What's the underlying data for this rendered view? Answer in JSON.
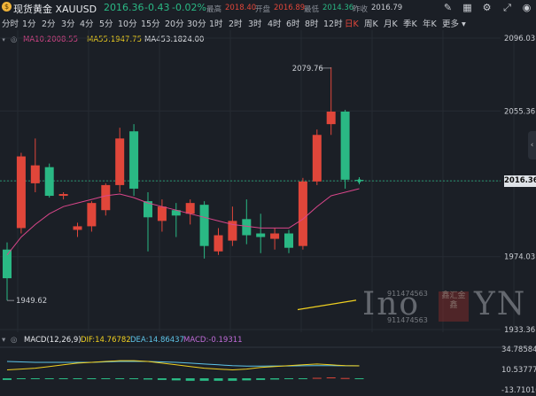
{
  "header": {
    "symbol": "现货黄金 XAUUSD",
    "price": "2016.36",
    "change": "-0.43",
    "change_pct": "-0.02%",
    "high_label": "最高",
    "high": "2018.40",
    "open_label": "开盘",
    "open": "2016.89",
    "low_label": "最低",
    "low": "2014.36",
    "prev_close_label": "昨收",
    "prev_close": "2016.79"
  },
  "timeframes": [
    "分时",
    "1分",
    "2分",
    "3分",
    "4分",
    "5分",
    "10分",
    "15分",
    "20分",
    "30分",
    "1时",
    "2时",
    "3时",
    "4时",
    "6时",
    "8时",
    "12时",
    "日K",
    "周K",
    "月K",
    "季K",
    "年K",
    "更多"
  ],
  "active_timeframe": "日K",
  "ma_legend": {
    "ma10": "MA10:2008.55",
    "ma55": "MA55:1947.75",
    "ma453": "MA453:1824.00"
  },
  "price_axis": [
    "2096.03",
    "2055.36",
    "2016.36",
    "1974.03",
    "1933.36"
  ],
  "price_tag": "2016.36",
  "annotations": {
    "high": "2079.76",
    "low": "1949.62"
  },
  "macd_legend": {
    "title": "MACD(12,26,9)",
    "dif": "DIF:14.76782",
    "dea": "DEA:14.86437",
    "macd": "MACD:-0.19311"
  },
  "macd_axis": [
    "34.78584",
    "10.53777",
    "-13.71010"
  ],
  "watermark": {
    "text_left": "Ino",
    "text_right": "YN",
    "number": "911474563",
    "seal": "鑫汇金鑫"
  },
  "colors": {
    "up": "#e0463a",
    "down": "#2ab884",
    "ma10": "#d9468a",
    "ma55": "#f0d020",
    "bg": "#1b1f26"
  },
  "chart_data": {
    "type": "candlestick",
    "title": "现货黄金 XAUUSD",
    "ylim": [
      1933.36,
      2096.03
    ],
    "candles": [
      {
        "o": 1978,
        "h": 1982,
        "l": 1949.62,
        "c": 1962
      },
      {
        "o": 1990,
        "h": 2032,
        "l": 1987,
        "c": 2030
      },
      {
        "o": 2015,
        "h": 2040,
        "l": 2010,
        "c": 2025
      },
      {
        "o": 2024,
        "h": 2026,
        "l": 2007,
        "c": 2008
      },
      {
        "o": 2008,
        "h": 2010,
        "l": 2006,
        "c": 2009
      },
      {
        "o": 1989,
        "h": 1993,
        "l": 1985,
        "c": 1991
      },
      {
        "o": 1991,
        "h": 2005,
        "l": 1988,
        "c": 2004
      },
      {
        "o": 2000,
        "h": 2015,
        "l": 1997,
        "c": 2014
      },
      {
        "o": 2014,
        "h": 2046,
        "l": 2010,
        "c": 2040
      },
      {
        "o": 2044,
        "h": 2048,
        "l": 2008,
        "c": 2012
      },
      {
        "o": 2005,
        "h": 2010,
        "l": 1977,
        "c": 1996
      },
      {
        "o": 1994,
        "h": 2006,
        "l": 1988,
        "c": 2002
      },
      {
        "o": 2000,
        "h": 2004,
        "l": 1985,
        "c": 1997
      },
      {
        "o": 1998,
        "h": 2006,
        "l": 1992,
        "c": 2004
      },
      {
        "o": 2003,
        "h": 2005,
        "l": 1973,
        "c": 1980
      },
      {
        "o": 1977,
        "h": 1990,
        "l": 1975,
        "c": 1986
      },
      {
        "o": 1983,
        "h": 2002,
        "l": 1980,
        "c": 1994
      },
      {
        "o": 1995,
        "h": 2006,
        "l": 1981,
        "c": 1986
      },
      {
        "o": 1987,
        "h": 1998,
        "l": 1976,
        "c": 1985
      },
      {
        "o": 1984,
        "h": 1990,
        "l": 1978,
        "c": 1987
      },
      {
        "o": 1987,
        "h": 1989,
        "l": 1976,
        "c": 1979
      },
      {
        "o": 1980,
        "h": 2018,
        "l": 1978,
        "c": 2016
      },
      {
        "o": 2016,
        "h": 2045,
        "l": 2014,
        "c": 2042
      },
      {
        "o": 2048,
        "h": 2079.76,
        "l": 2042,
        "c": 2055
      },
      {
        "o": 2055,
        "h": 2056,
        "l": 2012,
        "c": 2017
      },
      {
        "o": 2016.89,
        "h": 2018.4,
        "l": 2014.36,
        "c": 2016.36
      }
    ],
    "ma10": [
      1975,
      1985,
      1992,
      1998,
      2002,
      2004,
      2006,
      2008,
      2009,
      2007,
      2004,
      2002,
      2000,
      1998,
      1996,
      1994,
      1992,
      1991,
      1990,
      1990,
      1990,
      1995,
      2002,
      2008,
      2010,
      2012
    ],
    "ma55": [
      1944.5,
      1947.75
    ],
    "macd": {
      "dif": [
        10,
        11,
        12,
        14,
        16,
        18,
        19,
        20,
        21,
        21,
        20,
        18,
        16,
        14,
        12,
        11,
        10,
        11,
        13,
        14,
        15,
        16,
        17,
        16,
        15,
        14.77
      ],
      "dea": [
        20,
        19.5,
        19,
        19,
        19,
        19,
        19,
        19.5,
        20,
        20,
        20,
        19.5,
        19,
        18,
        17,
        16,
        15,
        14.5,
        14.5,
        14.6,
        14.7,
        14.9,
        15,
        15,
        14.9,
        14.86
      ],
      "hist": [
        -2,
        -1,
        -1,
        -1,
        -1,
        -1,
        -1,
        -1,
        -1,
        -1,
        -1.5,
        -2,
        -2.5,
        -3,
        -3,
        -3,
        -3,
        -2.5,
        -2,
        -1.5,
        -1,
        -0.5,
        0.5,
        1,
        0.3,
        -0.2
      ]
    }
  }
}
